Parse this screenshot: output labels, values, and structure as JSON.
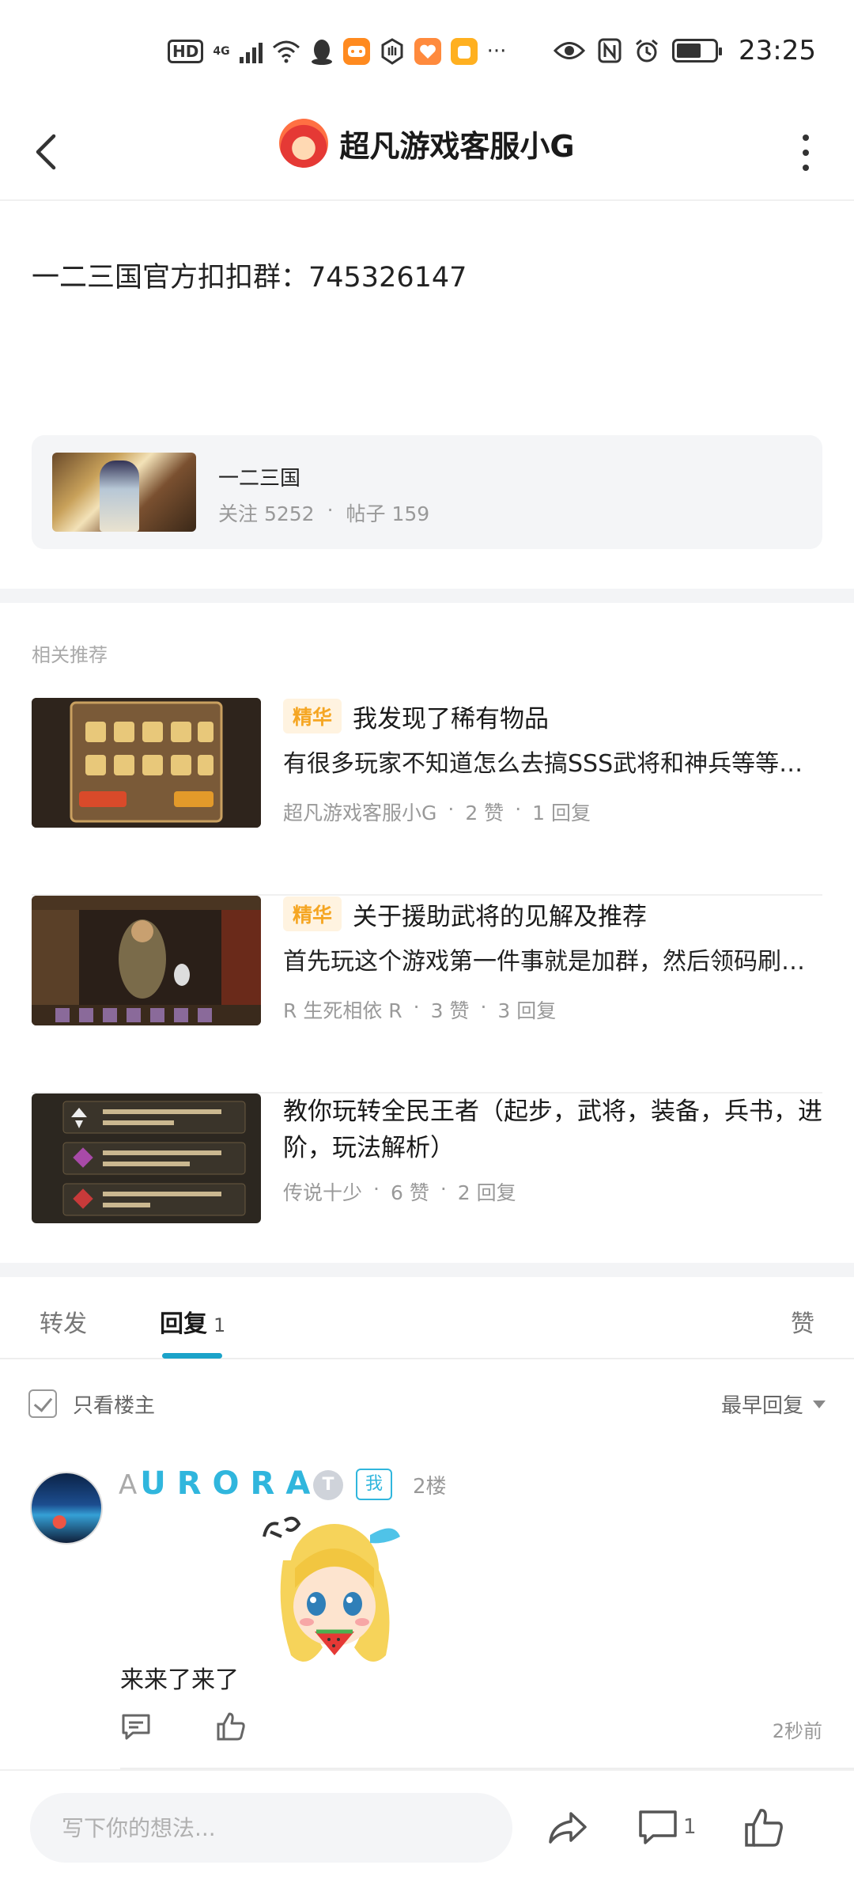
{
  "status_bar": {
    "time": "23:25",
    "hd": "HD",
    "network": "4G",
    "more": "···"
  },
  "header": {
    "title": "超凡游戏客服小G"
  },
  "post": {
    "text": "一二三国官方扣扣群：745326147"
  },
  "forum": {
    "name": "一二三国",
    "followers": "关注 5252",
    "dot": "·",
    "posts": "帖子 159"
  },
  "related": {
    "title": "相关推荐",
    "items": [
      {
        "badge": "精华",
        "title": "我发现了稀有物品",
        "summary": "有很多玩家不知道怎么去搞SSS武将和神兵等等…",
        "author": "超凡游戏客服小G",
        "likes": "2 赞",
        "replies": "1 回复"
      },
      {
        "badge": "精华",
        "title": "关于援助武将的见解及推荐",
        "summary": "首先玩这个游戏第一件事就是加群，然后领码刷…",
        "author": "R 生死相依 R",
        "likes": "3 赞",
        "replies": "3 回复"
      },
      {
        "badge": "",
        "title": "教你玩转全民王者（起步，武将，装备，兵书，进阶，玩法解析）",
        "summary": "",
        "author": "传说十少",
        "likes": "6 赞",
        "replies": "2 回复"
      }
    ]
  },
  "tabs": {
    "forward": "转发",
    "reply": "回复",
    "reply_count": "1",
    "like": "赞"
  },
  "filter": {
    "only_op": "只看楼主",
    "sort": "最早回复"
  },
  "reply": {
    "name_prefix": "A",
    "name": "URORA",
    "level": "T",
    "me_badge": "我",
    "floor": "2楼",
    "text": "来来了来了",
    "time": "2秒前"
  },
  "bottom": {
    "placeholder": "写下你的想法...",
    "comment_count": "1"
  }
}
